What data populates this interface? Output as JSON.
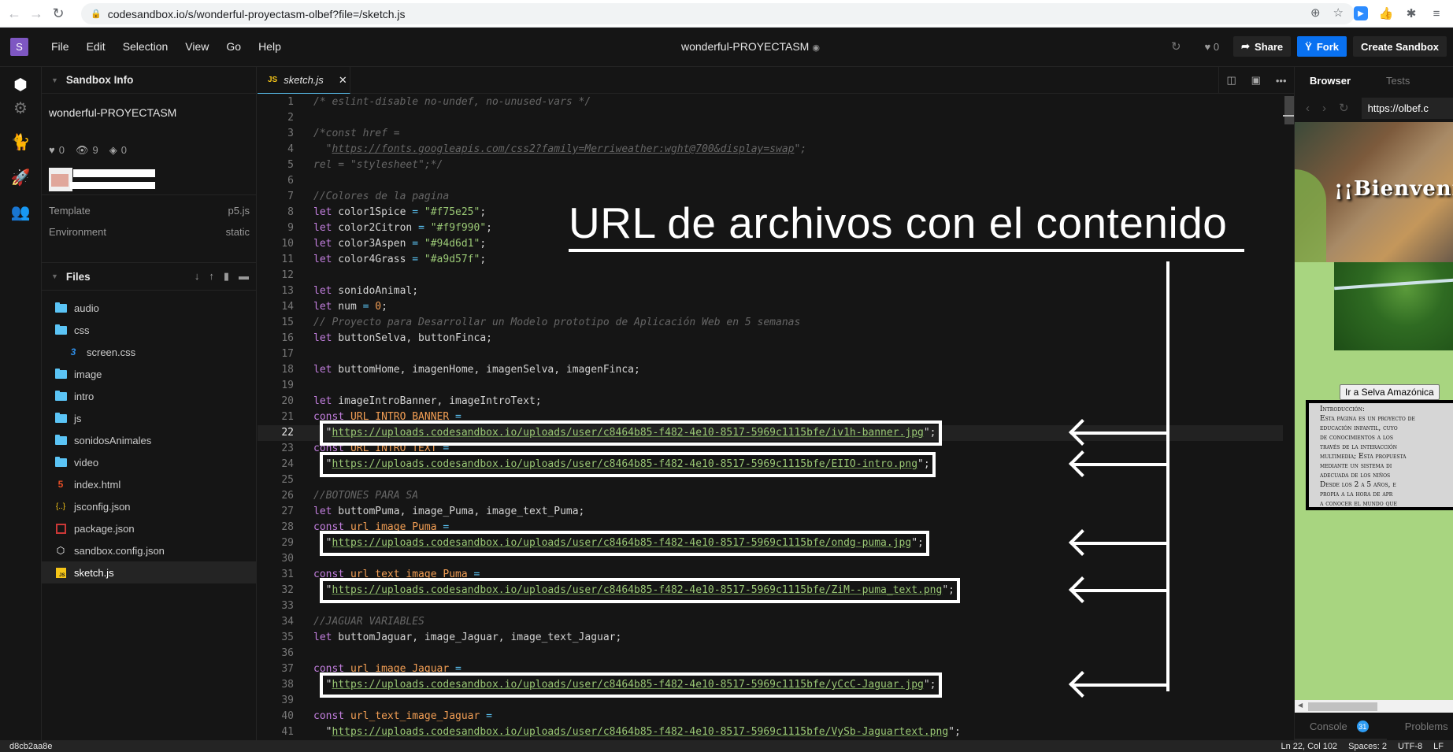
{
  "browser": {
    "url": "codesandbox.io/s/wonderful-proyectasm-olbef?file=/sketch.js",
    "icons": [
      "back-arrow",
      "forward-arrow",
      "reload",
      "lock",
      "add-tab",
      "bookmark-star",
      "zoom-extension",
      "thumbs-up-extension",
      "puzzle-extensions",
      "media-control"
    ]
  },
  "menubar": {
    "logo": "S",
    "menus": [
      "File",
      "Edit",
      "Selection",
      "View",
      "Go",
      "Help"
    ],
    "title": "wonderful-PROYECTASM",
    "likes": "0",
    "share_label": "Share",
    "fork_label": "Fork",
    "create_label": "Create Sandbox"
  },
  "sidebar": {
    "section_title": "Sandbox Info",
    "sandbox_name": "wonderful-PROYECTASM",
    "stats": {
      "likes": "0",
      "views": "9",
      "forks": "0"
    },
    "template_label": "Template",
    "template_value": "p5.js",
    "environment_label": "Environment",
    "environment_value": "static",
    "files_title": "Files",
    "files": [
      {
        "name": "audio",
        "type": "folder"
      },
      {
        "name": "css",
        "type": "folder-open"
      },
      {
        "name": "screen.css",
        "type": "css",
        "indent": true
      },
      {
        "name": "image",
        "type": "folder"
      },
      {
        "name": "intro",
        "type": "folder"
      },
      {
        "name": "js",
        "type": "folder"
      },
      {
        "name": "sonidosAnimales",
        "type": "folder"
      },
      {
        "name": "video",
        "type": "folder"
      },
      {
        "name": "index.html",
        "type": "html"
      },
      {
        "name": "jsconfig.json",
        "type": "json"
      },
      {
        "name": "package.json",
        "type": "npm"
      },
      {
        "name": "sandbox.config.json",
        "type": "sandbox"
      },
      {
        "name": "sketch.js",
        "type": "js",
        "active": true
      }
    ]
  },
  "editor": {
    "tab_label": "sketch.js",
    "tab_badge": "JS",
    "base_url": "https://uploads.codesandbox.io/uploads/user/c8464b85-f482-4e10-8517-5969c1115bfe/",
    "lines": [
      "/* eslint-disable no-undef, no-unused-vars */",
      "",
      "/*const href =",
      "  \"https://fonts.googleapis.com/css2?family=Merriweather:wght@700&display=swap\";",
      "rel = \"stylesheet\";*/",
      "",
      "//Colores de la pagina",
      "let color1Spice = \"#f75e25\";",
      "let color2Citron = \"#f9f990\";",
      "let color3Aspen = \"#94d6d1\";",
      "let color4Grass = \"#a9d57f\";",
      "",
      "let sonidoAnimal;",
      "let num = 0;",
      "// Proyecto para Desarrollar un Modelo prototipo de Aplicación Web en 5 semanas",
      "let buttonSelva, buttonFinca;",
      "",
      "let buttomHome, imagenHome, imagenSelva, imagenFinca;",
      "",
      "let imageIntroBanner, imageIntroText;",
      "const URL_INTRO_BANNER =",
      "  \"https://uploads.codesandbox.io/uploads/user/c8464b85-f482-4e10-8517-5969c1115bfe/iv1h-banner.jpg\";",
      "const URL_INTRO_TEXT =",
      "  \"https://uploads.codesandbox.io/uploads/user/c8464b85-f482-4e10-8517-5969c1115bfe/EIIO-intro.png\";",
      "",
      "//BOTONES PARA SA",
      "let buttomPuma, image_Puma, image_text_Puma;",
      "const url_image_Puma =",
      "  \"https://uploads.codesandbox.io/uploads/user/c8464b85-f482-4e10-8517-5969c1115bfe/ondg-puma.jpg\";",
      "",
      "const url_text_image_Puma =",
      "  \"https://uploads.codesandbox.io/uploads/user/c8464b85-f482-4e10-8517-5969c1115bfe/ZiM--puma_text.png\";",
      "",
      "//JAGUAR VARIABLES",
      "let buttomJaguar, image_Jaguar, image_text_Jaguar;",
      "",
      "const url_image_Jaguar =",
      "  \"https://uploads.codesandbox.io/uploads/user/c8464b85-f482-4e10-8517-5969c1115bfe/yCcC-Jaguar.jpg\";",
      "",
      "const url_text_image_Jaguar =",
      "  \"https://uploads.codesandbox.io/uploads/user/c8464b85-f482-4e10-8517-5969c1115bfe/VySb-Jaguartext.png\";"
    ],
    "current_line": 22
  },
  "annotation": {
    "title": "URL de archivos con el contenido",
    "highlighted_lines": [
      22,
      24,
      29,
      32,
      38
    ]
  },
  "preview": {
    "tab_browser": "Browser",
    "tab_tests": "Tests",
    "url": "https://olbef.c",
    "banner_text": "¡¡Bienvenidos",
    "button_label": "Ir a Selva Amazónica",
    "intro_lines": [
      "Introducción:",
      "Esta página es un proyecto de",
      "educación infantil, cuyo",
      "de conocimientos a los",
      "través de la interacción",
      "multimedia; Esta propuesta",
      "mediante un sistema di",
      "adecuada de los niños",
      "Desde los 2 a 5 años, e",
      "propia a la hora de apr",
      "a conocer el mundo que"
    ],
    "console_label": "Console",
    "console_count": "31",
    "problems_label": "Problems"
  },
  "status": {
    "hash": "d8cb2aa8e",
    "position": "Ln 22, Col 102",
    "spaces": "Spaces: 2",
    "encoding": "UTF-8",
    "eol": "LF"
  }
}
